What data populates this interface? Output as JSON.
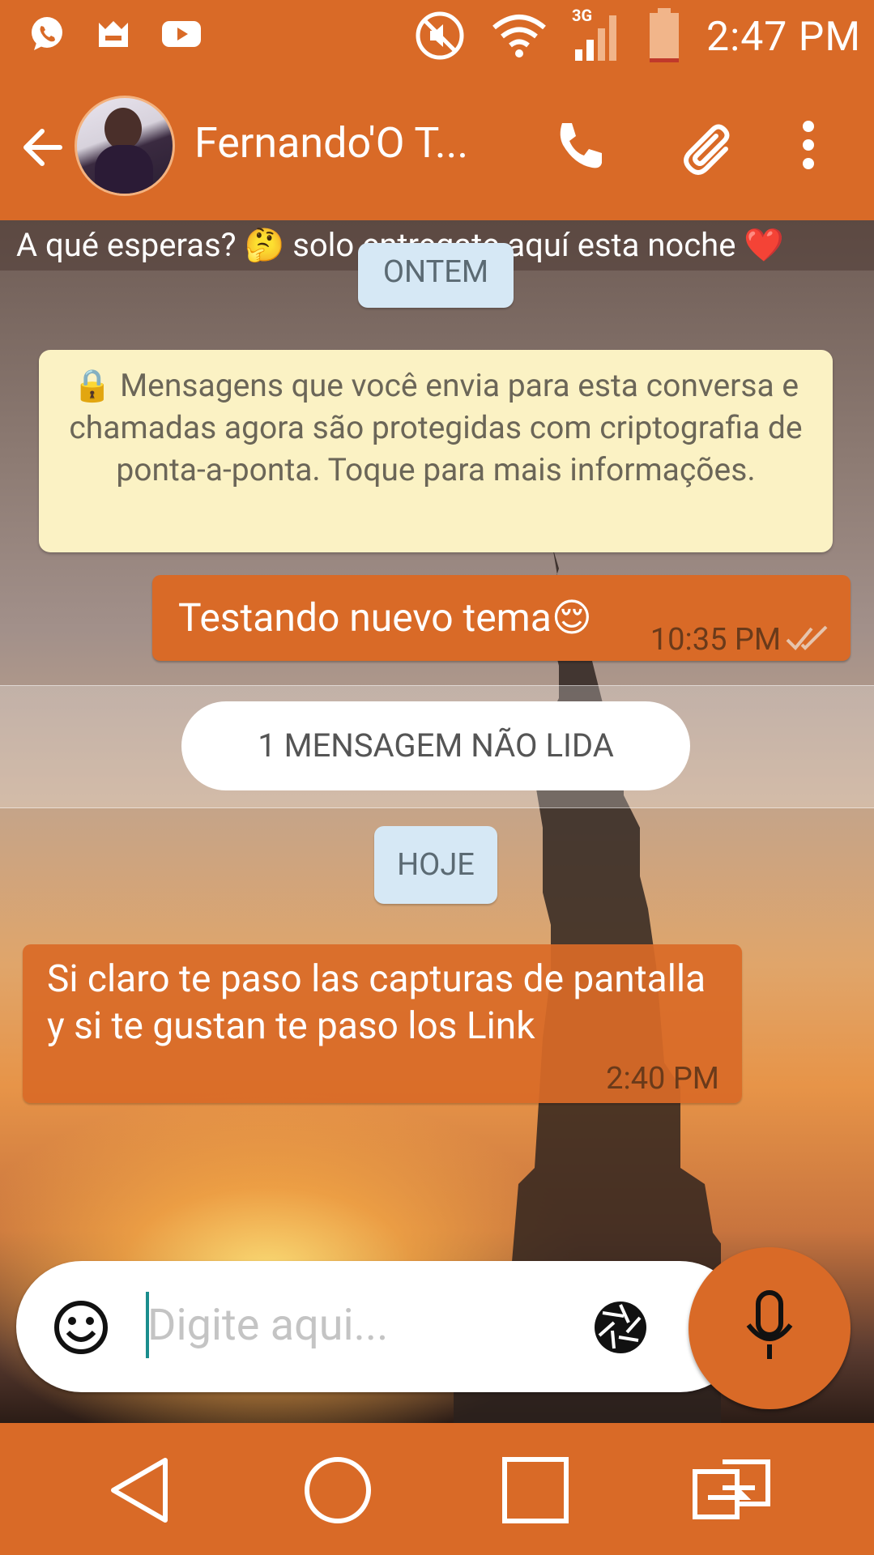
{
  "status_bar": {
    "time": "2:47 PM",
    "network": "3G",
    "icons": [
      "whatsapp-icon",
      "notification-app-icon",
      "youtube-icon",
      "mute-icon",
      "wifi-icon",
      "signal-icon",
      "battery-icon"
    ]
  },
  "toolbar": {
    "contact_name": "Fernando'O T...",
    "icons": [
      "back-arrow-icon",
      "call-icon",
      "attach-icon",
      "more-vert-icon"
    ]
  },
  "chat": {
    "contact_status": "A qué esperas? 🤔 solo entregate aquí esta noche ❤️",
    "date_yesterday": "ONTEM",
    "encryption_notice": "🔒 Mensagens que você envia para esta conversa e chamadas agora são protegidas com criptografia de ponta-a-ponta. Toque para mais informações.",
    "messages": [
      {
        "direction": "out",
        "text": "Testando nuevo tema😌",
        "time": "10:35 PM",
        "status": "read"
      },
      {
        "direction": "in",
        "text": "Si claro te paso las capturas de pantalla y si te gustan te paso los Link",
        "time": "2:40 PM"
      }
    ],
    "unread_label": "1 MENSAGEM NÃO LIDA",
    "date_today": "HOJE"
  },
  "composer": {
    "placeholder": "Digite aqui...",
    "icons": [
      "emoji-icon",
      "camera-icon",
      "mic-icon"
    ]
  },
  "navbar": {
    "icons": [
      "nav-back-icon",
      "nav-home-icon",
      "nav-recents-icon",
      "dual-window-icon"
    ]
  },
  "colors": {
    "accent": "#d96a27",
    "notice_bg": "#fbf2c4",
    "date_chip_bg": "#d6e8f5"
  }
}
